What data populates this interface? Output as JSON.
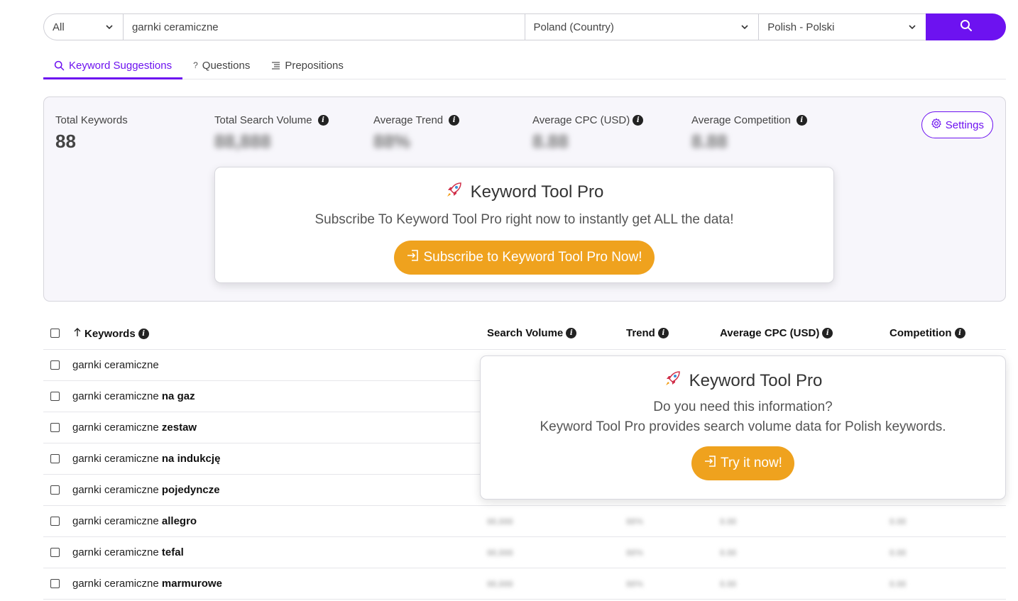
{
  "search": {
    "type_value": "All",
    "query": "garnki ceramiczne",
    "country": "Poland (Country)",
    "language": "Polish - Polski"
  },
  "tabs": [
    {
      "label": "Keyword Suggestions",
      "icon": "search-icon",
      "active": true
    },
    {
      "label": "Questions",
      "icon": "question-icon",
      "active": false
    },
    {
      "label": "Prepositions",
      "icon": "list-icon",
      "active": false
    }
  ],
  "stats": {
    "total_keywords_label": "Total Keywords",
    "total_keywords_value": "88",
    "total_search_volume_label": "Total Search Volume",
    "total_search_volume_value": "88,888",
    "average_trend_label": "Average Trend",
    "average_trend_value": "88%",
    "average_cpc_label": "Average CPC (USD)",
    "average_cpc_value": "8.88",
    "average_competition_label": "Average Competition",
    "average_competition_value": "8.88",
    "settings_label": "Settings"
  },
  "promo_top": {
    "title": "Keyword Tool Pro",
    "text": "Subscribe To Keyword Tool Pro right now to instantly get ALL the data!",
    "button": "Subscribe to Keyword Tool Pro Now!"
  },
  "promo_table": {
    "title": "Keyword Tool Pro",
    "line1": "Do you need this information?",
    "line2": "Keyword Tool Pro provides search volume data for Polish keywords.",
    "button": "Try it now!"
  },
  "table": {
    "columns": {
      "keywords": "Keywords",
      "search_volume": "Search Volume",
      "trend": "Trend",
      "average_cpc": "Average CPC (USD)",
      "competition": "Competition"
    },
    "blurred": {
      "volume": "88,888",
      "trend": "88%",
      "cpc": "8.88",
      "competition": "8.88"
    },
    "rows": [
      {
        "base": "garnki ceramiczne",
        "suffix": ""
      },
      {
        "base": "garnki ceramiczne ",
        "suffix": "na gaz"
      },
      {
        "base": "garnki ceramiczne ",
        "suffix": "zestaw"
      },
      {
        "base": "garnki ceramiczne ",
        "suffix": "na indukcję"
      },
      {
        "base": "garnki ceramiczne ",
        "suffix": "pojedyncze"
      },
      {
        "base": "garnki ceramiczne ",
        "suffix": "allegro"
      },
      {
        "base": "garnki ceramiczne ",
        "suffix": "tefal"
      },
      {
        "base": "garnki ceramiczne ",
        "suffix": "marmurowe"
      }
    ]
  },
  "colors": {
    "accent": "#6d12f0",
    "orange": "#efa21e",
    "panel_bg": "#f7f6fb"
  }
}
